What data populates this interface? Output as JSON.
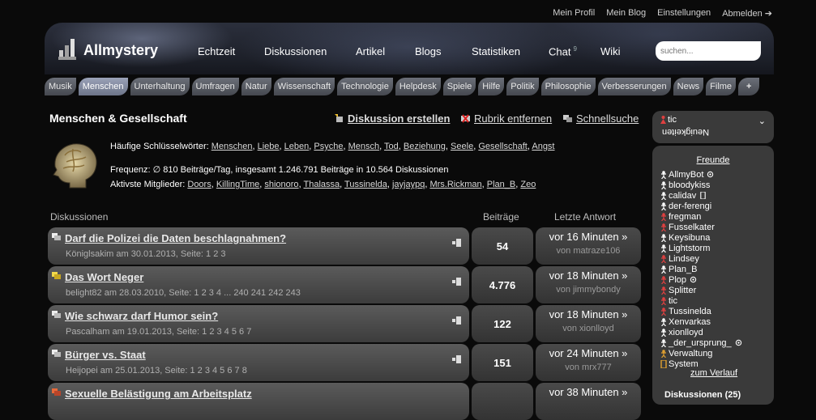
{
  "toplinks": [
    "Mein Profil",
    "Mein Blog",
    "Einstellungen",
    "Abmelden ➔"
  ],
  "logo": {
    "text": "Allmystery"
  },
  "mainnav": [
    {
      "label": "Echtzeit"
    },
    {
      "label": "Diskussionen"
    },
    {
      "label": "Artikel"
    },
    {
      "label": "Blogs"
    },
    {
      "label": "Statistiken"
    },
    {
      "label": "Chat",
      "badge": "9"
    },
    {
      "label": "Wiki"
    }
  ],
  "search": {
    "placeholder": "suchen..."
  },
  "categories": [
    "Musik",
    "Menschen",
    "Unterhaltung",
    "Umfragen",
    "Natur",
    "Wissenschaft",
    "Technologie",
    "Helpdesk",
    "Spiele",
    "Hilfe",
    "Politik",
    "Philosophie",
    "Verbesserungen",
    "News",
    "Filme",
    "+"
  ],
  "active_category": "Menschen",
  "page": {
    "title": "Menschen & Gesellschaft",
    "actions": [
      "Diskussion erstellen",
      "Rubrik entfernen",
      "Schnellsuche"
    ]
  },
  "info": {
    "keywords_label": "Häufige Schlüsselwörter:",
    "keywords": [
      "Menschen",
      "Liebe",
      "Leben",
      "Psyche",
      "Mensch",
      "Tod",
      "Beziehung",
      "Seele",
      "Gesellschaft",
      "Angst"
    ],
    "frequency": "Frequenz: ∅ 810 Beiträge/Tag, insgesamt 1.246.791 Beiträge in 10.564 Diskussionen",
    "members_label": "Aktivste Mitglieder:",
    "members": [
      "Doors",
      "KillingTime",
      "shionoro",
      "Thalassa",
      "Tussinelda",
      "jayjaypq",
      "Mrs.Rickman",
      "Plan_B",
      "Zeo"
    ]
  },
  "table_headers": {
    "discussions": "Diskussionen",
    "posts": "Beiträge",
    "last": "Letzte Antwort"
  },
  "rows": [
    {
      "title": "Darf die Polizei die Daten beschlagnahmen?",
      "meta": "Königlsakim am 30.01.2013, Seite: 1 2 3",
      "count": "54",
      "last_time": "vor 16 Minuten »",
      "last_user": "von matraze106"
    },
    {
      "title": "Das Wort Neger",
      "meta": "belight82 am 28.03.2010, Seite: 1 2 3 4 ... 240 241 242 243",
      "count": "4.776",
      "last_time": "vor 18 Minuten »",
      "last_user": "von jimmybondy"
    },
    {
      "title": "Wie schwarz darf Humor sein?",
      "meta": "Pascalham am 19.01.2013, Seite: 1 2 3 4 5 6 7",
      "count": "122",
      "last_time": "vor 18 Minuten »",
      "last_user": "von xionlloyd"
    },
    {
      "title": "Bürger vs. Staat",
      "meta": "Heijopei am 25.01.2013, Seite: 1 2 3 4 5 6 7 8",
      "count": "151",
      "last_time": "vor 24 Minuten »",
      "last_user": "von mrx777"
    },
    {
      "title": "Sexuelle Belästigung am Arbeitsplatz",
      "meta": "",
      "count": "",
      "last_time": "vor 38 Minuten »",
      "last_user": ""
    }
  ],
  "userbox": {
    "name": "tic",
    "reversed": "Neuigkeiten"
  },
  "friends": {
    "heading": "Freunde",
    "list": [
      "AllmyBot",
      "bloodykiss",
      "calidav",
      "der-ferengi",
      "fregman",
      "Fusselkater",
      "Keysibuna",
      "Lightstorm",
      "Lindsey",
      "Plan_B",
      "Plop",
      "Splitter",
      "tic",
      "Tussinelda",
      "Xenvarkas",
      "xionlloyd",
      "_der_ursprung_",
      "Verwaltung",
      "System"
    ],
    "verlauf": "zum Verlauf",
    "discussions": "Diskussionen (25)"
  }
}
